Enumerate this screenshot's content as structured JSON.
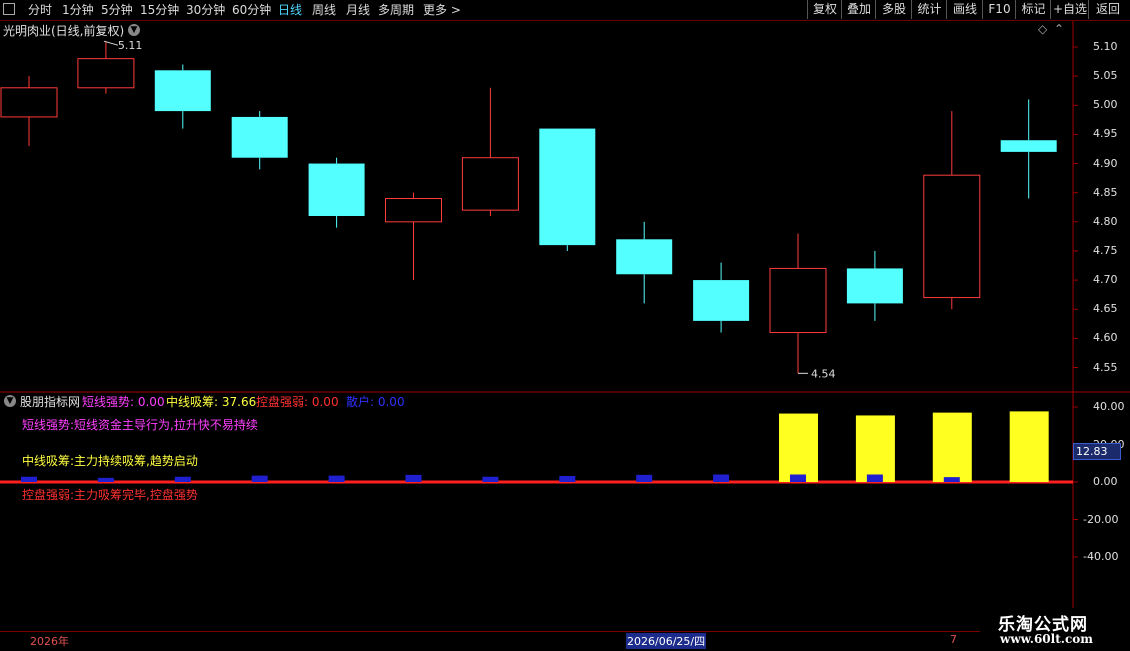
{
  "toolbar": {
    "periods": [
      {
        "label": "分时",
        "active": false
      },
      {
        "label": "1分钟",
        "active": false
      },
      {
        "label": "5分钟",
        "active": false
      },
      {
        "label": "15分钟",
        "active": false
      },
      {
        "label": "30分钟",
        "active": false
      },
      {
        "label": "60分钟",
        "active": false
      },
      {
        "label": "日线",
        "active": true
      },
      {
        "label": "周线",
        "active": false
      },
      {
        "label": "月线",
        "active": false
      },
      {
        "label": "多周期",
        "active": false
      },
      {
        "label": "更多",
        "active": false
      }
    ],
    "right_buttons": [
      "复权",
      "叠加",
      "多股",
      "统计",
      "画线",
      "F10",
      "标记",
      "+自选",
      "返回"
    ]
  },
  "main_chart": {
    "title": "光明肉业(日线,前复权)",
    "max_label": "5.11",
    "min_label": "4.54",
    "y_ticks": [
      "5.10",
      "5.05",
      "5.00",
      "4.95",
      "4.90",
      "4.85",
      "4.80",
      "4.75",
      "4.70",
      "4.65",
      "4.60",
      "4.55"
    ],
    "colors": {
      "up": "#ff3b3b",
      "down": "#54ffff"
    },
    "candles": [
      {
        "o": 4.98,
        "h": 5.05,
        "l": 4.93,
        "c": 5.03
      },
      {
        "o": 5.03,
        "h": 5.11,
        "l": 5.02,
        "c": 5.08
      },
      {
        "o": 5.06,
        "h": 5.07,
        "l": 4.96,
        "c": 4.99
      },
      {
        "o": 4.98,
        "h": 4.99,
        "l": 4.89,
        "c": 4.91
      },
      {
        "o": 4.9,
        "h": 4.91,
        "l": 4.79,
        "c": 4.81
      },
      {
        "o": 4.8,
        "h": 4.85,
        "l": 4.7,
        "c": 4.84
      },
      {
        "o": 4.82,
        "h": 5.03,
        "l": 4.81,
        "c": 4.91
      },
      {
        "o": 4.96,
        "h": 4.96,
        "l": 4.75,
        "c": 4.76
      },
      {
        "o": 4.77,
        "h": 4.8,
        "l": 4.66,
        "c": 4.71
      },
      {
        "o": 4.7,
        "h": 4.73,
        "l": 4.61,
        "c": 4.63
      },
      {
        "o": 4.61,
        "h": 4.78,
        "l": 4.54,
        "c": 4.72
      },
      {
        "o": 4.72,
        "h": 4.75,
        "l": 4.63,
        "c": 4.66
      },
      {
        "o": 4.67,
        "h": 4.99,
        "l": 4.65,
        "c": 4.88
      },
      {
        "o": 4.94,
        "h": 5.01,
        "l": 4.84,
        "c": 4.92
      }
    ]
  },
  "indicator": {
    "name": "股朋指标网",
    "fields": [
      {
        "label": "短线强势:",
        "value": "0.00",
        "color": "#ff40ff"
      },
      {
        "label": "中线吸筹:",
        "value": "37.66",
        "color": "#ffff40"
      },
      {
        "label": "控盘强弱:",
        "value": "0.00",
        "color": "#ff3030"
      },
      {
        "label": "散户:",
        "value": "0.00",
        "color": "#3030ff"
      }
    ],
    "notes": [
      {
        "text": "短线强势:短线资金主导行为,拉升快不易持续",
        "color": "#ff40ff"
      },
      {
        "text": "中线吸筹:主力持续吸筹,趋势启动",
        "color": "#ffff40"
      },
      {
        "text": "控盘强弱:主力吸筹完毕,控盘强势",
        "color": "#ff3030"
      }
    ],
    "y_ticks": [
      "40.00",
      "20.00",
      "0.00",
      "-20.00",
      "-40.00"
    ],
    "current_value": "12.83",
    "yellow_bars": [
      0,
      0,
      0,
      0,
      0,
      0,
      0,
      0,
      0,
      0,
      36.5,
      35.5,
      37,
      37.66
    ],
    "blue_bars": [
      2.8,
      2.2,
      2.8,
      3.4,
      3.4,
      3.8,
      2.8,
      3.2,
      3.8,
      4.0,
      4.0,
      4.0,
      2.6,
      0
    ]
  },
  "bottom_bar": {
    "year_label": "2026年",
    "date_label": "2026/06/25/四",
    "right_label": "7"
  },
  "watermark": {
    "line1": "乐淘公式网",
    "line2": "www.60lt.com"
  }
}
